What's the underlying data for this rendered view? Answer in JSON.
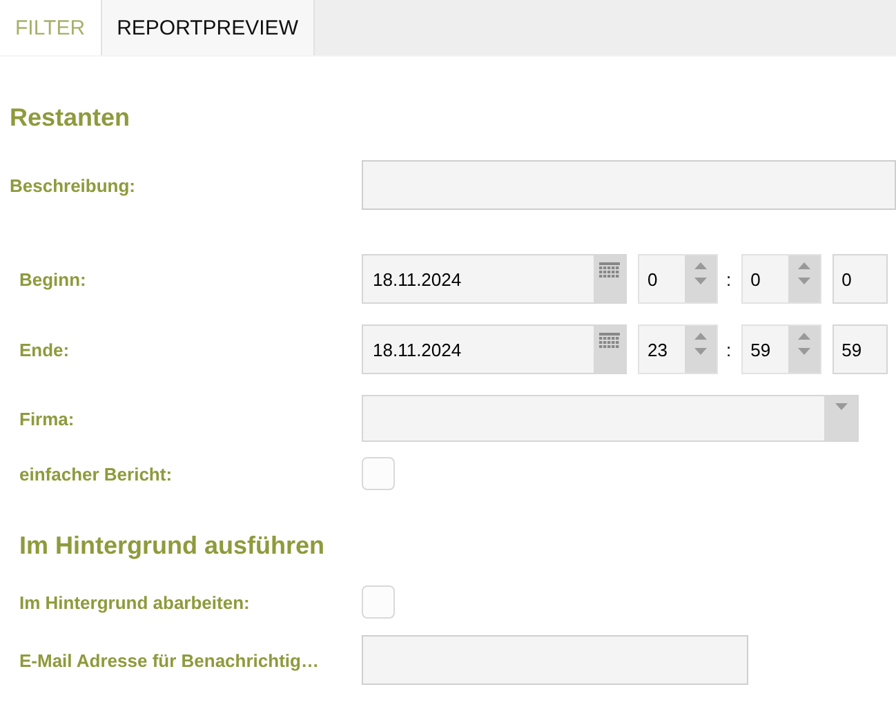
{
  "tabs": [
    {
      "label": "FILTER",
      "selected": true
    },
    {
      "label": "REPORTPREVIEW",
      "selected": false
    }
  ],
  "sections": [
    {
      "title": "Restanten",
      "fields": [
        {
          "kind": "text",
          "label": "Beschreibung:",
          "wide": true
        },
        {
          "kind": "datetime",
          "label": "Beginn:",
          "date": "18.11.2024",
          "separator": ":",
          "hour": "0",
          "minute": "0",
          "second": "0"
        },
        {
          "kind": "datetime",
          "label": "Ende:",
          "date": "18.11.2024",
          "separator": ":",
          "hour": "23",
          "minute": "59",
          "second": "59"
        },
        {
          "kind": "select",
          "label": "Firma:"
        },
        {
          "kind": "checkbox",
          "label": "einfacher Bericht:",
          "checked": false
        }
      ]
    },
    {
      "title": "Im Hintergrund ausführen",
      "fields": [
        {
          "kind": "checkbox",
          "label": "Im Hintergrund abarbeiten:",
          "checked": false
        },
        {
          "kind": "text",
          "label": "E-Mail Adresse für Benachrichtig…",
          "wide": false
        }
      ]
    }
  ]
}
